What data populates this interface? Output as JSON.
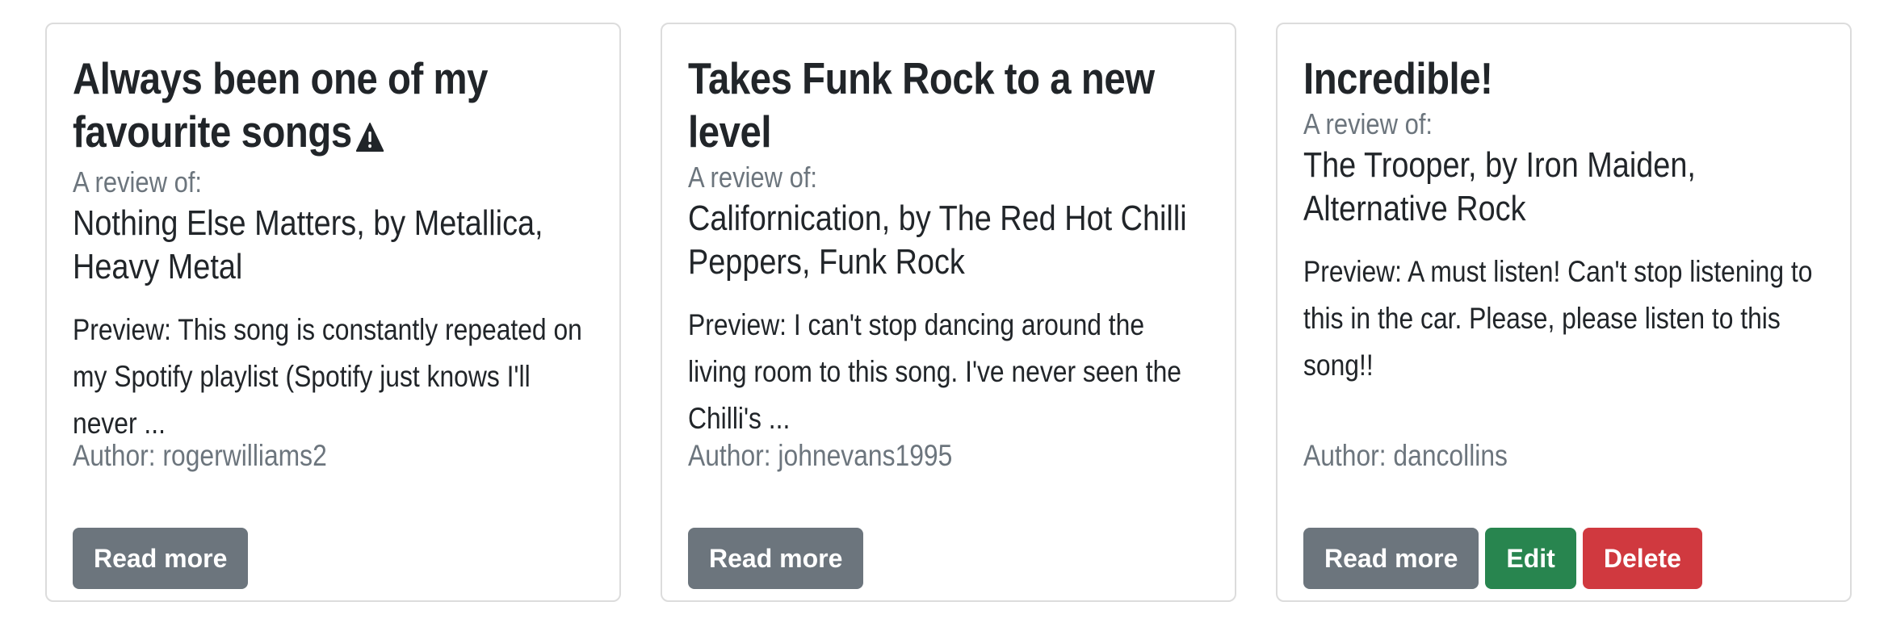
{
  "reviews": [
    {
      "title": "Always been one of my favourite songs",
      "has_warning": true,
      "warning_icon": "warning-triangle-icon",
      "subtitle": "A review of:",
      "song": "Nothing Else Matters, by Metallica, Heavy Metal",
      "preview": "Preview: This song is constantly repeated on my Spotify playlist (Spotify just knows I'll never ...",
      "author": "Author: rogerwilliams2",
      "read_more": "Read more"
    },
    {
      "title": "Takes Funk Rock to a new level",
      "has_warning": false,
      "subtitle": "A review of:",
      "song": "Californication, by The Red Hot Chilli Peppers, Funk Rock",
      "preview": "Preview: I can't stop dancing around the living room to this song. I've never seen the Chilli's ...",
      "author": "Author: johnevans1995",
      "read_more": "Read more"
    },
    {
      "title": "Incredible!",
      "has_warning": false,
      "subtitle": "A review of:",
      "song": "The Trooper, by Iron Maiden, Alternative Rock",
      "preview": "Preview: A must listen! Can't stop listening to this in the car. Please, please listen to this song!!",
      "author": "Author: dancollins",
      "read_more": "Read more",
      "edit": "Edit",
      "delete": "Delete"
    }
  ],
  "colors": {
    "secondary": "#6c757d",
    "success": "#28854f",
    "danger": "#d0393f",
    "text": "#212529"
  }
}
